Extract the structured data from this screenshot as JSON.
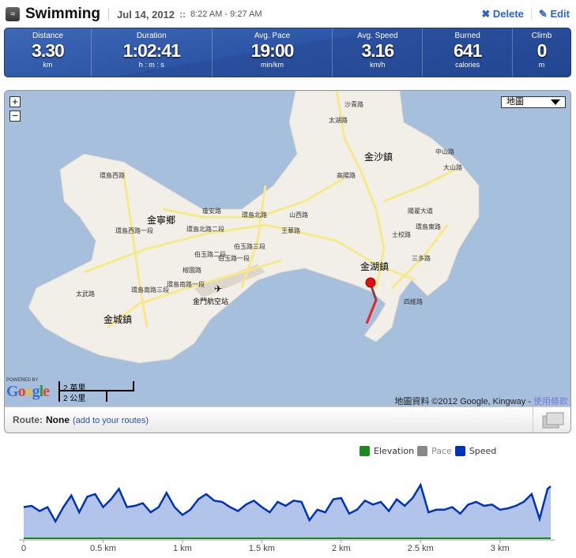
{
  "header": {
    "sport": "Swimming",
    "date": "Jul 14, 2012",
    "separator": "::",
    "time_range": "8:22 AM - 9:27 AM",
    "delete_label": "Delete",
    "edit_label": "Edit",
    "sport_icon": "swimmer-icon"
  },
  "stats": [
    {
      "label": "Distance",
      "value": "3.30",
      "unit": "km"
    },
    {
      "label": "Duration",
      "value": "1:02:41",
      "unit": "h : m : s"
    },
    {
      "label": "Avg. Pace",
      "value": "19:00",
      "unit": "min/km"
    },
    {
      "label": "Avg. Speed",
      "value": "3.16",
      "unit": "km/h"
    },
    {
      "label": "Burned",
      "value": "641",
      "unit": "calories"
    },
    {
      "label": "Climb",
      "value": "0",
      "unit": "m"
    }
  ],
  "map": {
    "zoom_in": "+",
    "zoom_out": "−",
    "map_type": "地圖",
    "powered_by": "POWERED BY",
    "logo": "Google",
    "scale_miles": "2 英里",
    "scale_km": "2 公里",
    "attribution": "地圖資料 ©2012 Google, Kingway - ",
    "terms": "使用條款",
    "places": [
      "金沙鎮",
      "金寧鄉",
      "金湖鎮",
      "金城鎮",
      "金門航空站"
    ],
    "roads": [
      "環島北路二段",
      "伯玉路二段",
      "伯玉路三段",
      "環島南路一段",
      "環島西路",
      "高陽路",
      "太湖路",
      "三多路",
      "四維路",
      "沙青路",
      "環島東路",
      "中山路",
      "王華路",
      "山西路",
      "榕園路",
      "伯玉路一段",
      "瓊安路",
      "環島西路一段",
      "陽翟大道",
      "大山路",
      "士校路",
      "環島北路",
      "太武路",
      "環島南路三段"
    ],
    "route_color": "#ee2222",
    "water_color": "#a5bfdd",
    "land_color": "#f2efe9",
    "road_color": "#f7e98a"
  },
  "route": {
    "label": "Route:",
    "value": "None",
    "link": "(add to your routes)"
  },
  "legend": [
    {
      "name": "Elevation",
      "color": "#1a8a1a"
    },
    {
      "name": "Pace",
      "color": "#888888"
    },
    {
      "name": "Speed",
      "color": "#0033bb"
    }
  ],
  "chart_data": {
    "type": "area",
    "xlabel": "",
    "ylabel": "",
    "x_ticks": [
      "0",
      "0.5 km",
      "1 km",
      "1.5 km",
      "2 km",
      "2.5 km",
      "3 km"
    ],
    "xlim": [
      0,
      3.32
    ],
    "series": [
      {
        "name": "Speed",
        "color": "#0033bb",
        "fill": "#b3c4ea",
        "x": [
          0,
          0.05,
          0.1,
          0.15,
          0.2,
          0.25,
          0.3,
          0.35,
          0.4,
          0.45,
          0.5,
          0.55,
          0.6,
          0.65,
          0.7,
          0.75,
          0.8,
          0.85,
          0.9,
          0.95,
          1.0,
          1.05,
          1.1,
          1.15,
          1.2,
          1.25,
          1.3,
          1.35,
          1.4,
          1.45,
          1.5,
          1.55,
          1.6,
          1.65,
          1.7,
          1.75,
          1.8,
          1.85,
          1.9,
          1.95,
          2.0,
          2.05,
          2.1,
          2.15,
          2.2,
          2.25,
          2.3,
          2.35,
          2.4,
          2.45,
          2.5,
          2.55,
          2.6,
          2.65,
          2.7,
          2.75,
          2.8,
          2.85,
          2.9,
          2.95,
          3.0,
          3.05,
          3.1,
          3.15,
          3.2,
          3.25,
          3.3,
          3.32
        ],
        "values": [
          3.16,
          3.29,
          2.76,
          3.16,
          1.71,
          3.16,
          4.34,
          2.63,
          4.21,
          4.48,
          3.16,
          3.95,
          5.0,
          3.16,
          3.29,
          3.55,
          2.63,
          3.16,
          4.61,
          3.16,
          2.37,
          2.9,
          3.95,
          4.48,
          3.82,
          3.69,
          3.16,
          2.76,
          3.42,
          3.82,
          3.16,
          2.63,
          3.69,
          3.29,
          3.82,
          3.69,
          1.84,
          2.9,
          2.63,
          3.95,
          4.08,
          2.5,
          2.9,
          3.82,
          3.42,
          3.69,
          2.76,
          3.95,
          3.29,
          4.08,
          5.4,
          2.63,
          2.9,
          2.9,
          3.16,
          2.5,
          3.42,
          3.69,
          3.29,
          3.42,
          2.9,
          3.03,
          3.29,
          3.69,
          4.48,
          1.97,
          5.0,
          5.27
        ]
      },
      {
        "name": "Elevation",
        "color": "#1a8a1a",
        "x": [
          0,
          3.32
        ],
        "values": [
          0,
          0
        ]
      }
    ]
  }
}
